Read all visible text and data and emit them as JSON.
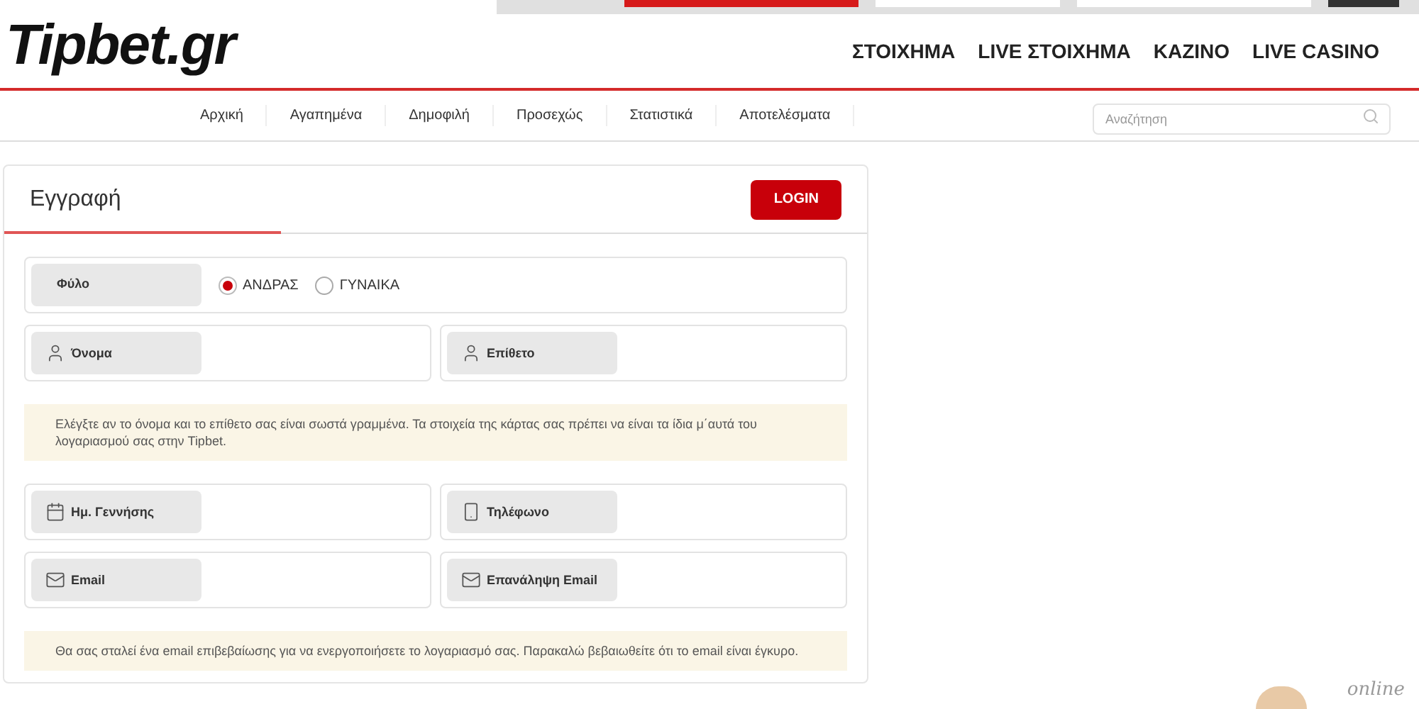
{
  "header": {
    "logo": "Tipbet.gr",
    "main_nav": [
      "ΣΤΟΙΧΗΜΑ",
      "LIVE ΣΤΟΙΧΗΜΑ",
      "ΚΑΖΙΝΟ",
      "LIVE CASINO"
    ]
  },
  "sub_nav": {
    "items": [
      "Αρχική",
      "Αγαπημένα",
      "Δημοφιλή",
      "Προσεχώς",
      "Στατιστικά",
      "Αποτελέσματα"
    ],
    "search": {
      "placeholder": "Αναζήτηση"
    }
  },
  "form": {
    "title": "Εγγραφή",
    "login_button": "LOGIN",
    "gender": {
      "label": "Φύλο",
      "options": [
        {
          "label": "ΑΝΔΡΑΣ",
          "selected": true
        },
        {
          "label": "ΓΥΝΑΙΚΑ",
          "selected": false
        }
      ]
    },
    "sections": [
      {
        "kind": "fields",
        "fields": [
          {
            "label": "Όνομα",
            "kind": "person"
          },
          {
            "label": "Επίθετο",
            "kind": "person"
          }
        ]
      },
      {
        "kind": "notice",
        "text": "Ελέγξτε αν το όνομα και το επίθετο σας είναι σωστά γραμμένα. Τα στοιχεία της κάρτας σας πρέπει να είναι τα ίδια μ΄αυτά του λογαριασμού σας στην Tipbet."
      },
      {
        "kind": "fields",
        "fields": [
          {
            "label": "Ημ. Γεννήσης",
            "kind": "date"
          },
          {
            "label": "Τηλέφωνο",
            "kind": "phone"
          }
        ]
      },
      {
        "kind": "fields",
        "fields": [
          {
            "label": "Email",
            "kind": "email"
          },
          {
            "label": "Επανάληψη Email",
            "kind": "email"
          }
        ]
      },
      {
        "kind": "notice",
        "text": "Θα σας σταλεί ένα email επιβεβαίωσης για να ενεργοποιήσετε το λογαριασμό σας. Παρακαλώ βεβαιωθείτε ότι το email είναι έγκυρο."
      }
    ]
  },
  "chat_widget": {
    "label": "online"
  }
}
